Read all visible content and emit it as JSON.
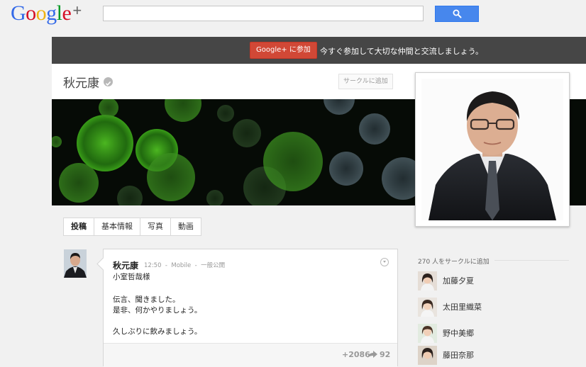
{
  "header": {
    "logo_letters": [
      "G",
      "o",
      "o",
      "g",
      "l",
      "e"
    ],
    "logo_plus": "+",
    "search_placeholder": ""
  },
  "banner": {
    "join_button": "Google+ に参加",
    "message": "今すぐ参加して大切な仲間と交流しましょう。"
  },
  "profile": {
    "name": "秋元康",
    "add_to_circle_label": "サークルに追加"
  },
  "tabs": [
    {
      "label": "投稿",
      "active": true
    },
    {
      "label": "基本情報",
      "active": false
    },
    {
      "label": "写真",
      "active": false
    },
    {
      "label": "動画",
      "active": false
    }
  ],
  "post": {
    "author": "秋元康",
    "time": "12:50",
    "via": "Mobile",
    "visibility": "一般公開",
    "lines": [
      "小室哲哉様",
      "",
      "伝言、聞きました。",
      "是非、何かやりましょう。",
      "",
      "久しぶりに飲みましょう。"
    ],
    "plus_count": "+2086",
    "share_count": "92"
  },
  "circles": {
    "heading": "270 人をサークルに追加",
    "people": [
      "加藤夕夏",
      "太田里織菜",
      "野中美郷",
      "藤田奈那"
    ]
  },
  "colors": {
    "accent_blue": "#4787ed",
    "join_red": "#d14836",
    "banner_gray": "#464646"
  }
}
